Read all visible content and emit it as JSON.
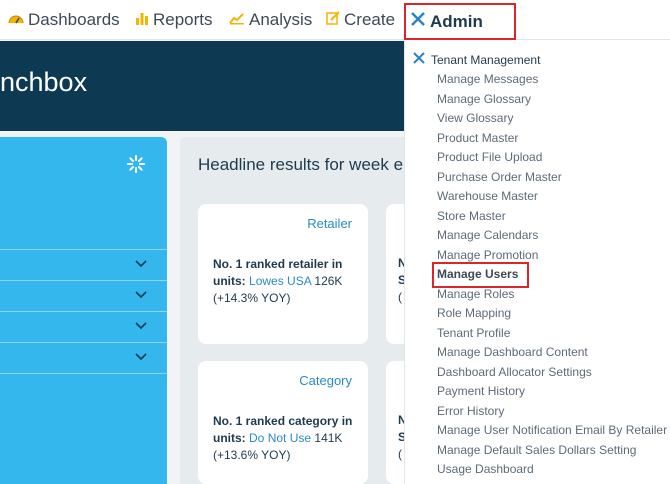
{
  "nav": {
    "dashboards": "Dashboards",
    "reports": "Reports",
    "analysis": "Analysis",
    "create": "Create",
    "admin": "Admin"
  },
  "hero": {
    "title": "nchbox"
  },
  "main": {
    "headline": "Headline results for week end",
    "cards": [
      {
        "category": "Retailer",
        "label": "No. 1 ranked retailer in units:",
        "link": "Lowes USA",
        "value": "126K",
        "change": "(+14.3% YOY)"
      },
      {
        "category": "Category",
        "label": "No. 1 ranked category in units:",
        "link": "Do Not Use",
        "value": "141K",
        "change": "(+13.6% YOY)"
      }
    ],
    "edge_chars": [
      "N",
      "S",
      "(",
      "N",
      "S",
      "("
    ]
  },
  "dropdown": {
    "section": "Tenant Management",
    "items": [
      "Manage Messages",
      "Manage Glossary",
      "View Glossary",
      "Product Master",
      "Product File Upload",
      "Purchase Order Master",
      "Warehouse Master",
      "Store Master",
      "Manage Calendars",
      "Manage Promotion",
      "Manage Users",
      "Manage Roles",
      "Role Mapping",
      "Tenant Profile",
      "Manage Dashboard Content",
      "Dashboard Allocator Settings",
      "Payment History",
      "Error History",
      "Manage User Notification Email By Retailer",
      "Manage Default Sales Dollars Setting",
      "Usage Dashboard"
    ],
    "highlighted": "Manage Users"
  },
  "colors": {
    "navy": "#0d3a52",
    "sky": "#33b7ec",
    "highlight": "#d9262c",
    "link": "#2a8bc9"
  }
}
